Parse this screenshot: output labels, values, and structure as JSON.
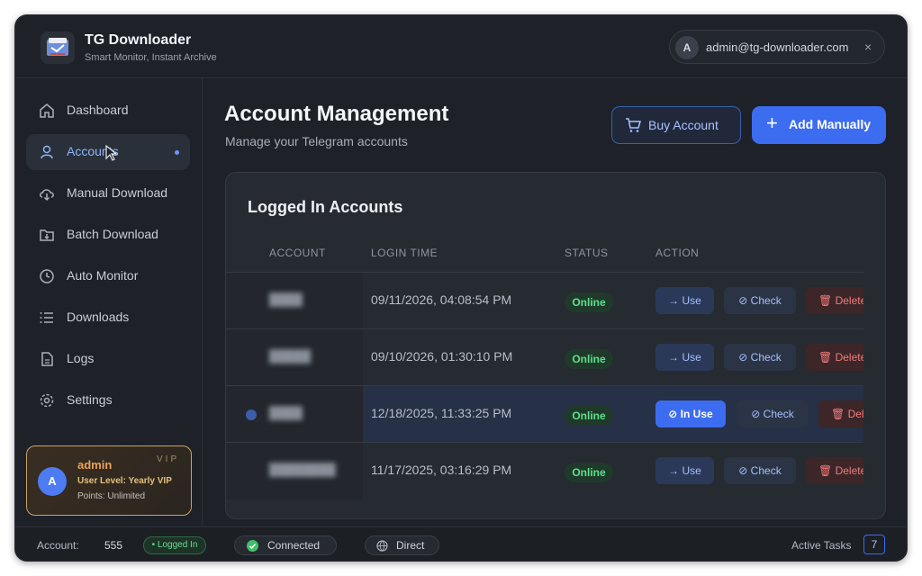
{
  "app": {
    "title": "TG Downloader",
    "subtitle": "Smart Monitor, Instant Archive"
  },
  "user": {
    "avatar_letter": "A",
    "email": "admin@tg-downloader.com",
    "close_glyph": "×"
  },
  "sidebar": {
    "items": [
      {
        "label": "Dashboard",
        "icon": "home-icon"
      },
      {
        "label": "Accounts",
        "icon": "user-icon",
        "active": true
      },
      {
        "label": "Manual Download",
        "icon": "cloud-download-icon"
      },
      {
        "label": "Batch Download",
        "icon": "folder-download-icon"
      },
      {
        "label": "Auto Monitor",
        "icon": "clock-icon"
      },
      {
        "label": "Downloads",
        "icon": "list-icon"
      },
      {
        "label": "Logs",
        "icon": "document-icon"
      },
      {
        "label": "Settings",
        "icon": "gear-icon"
      }
    ]
  },
  "vip": {
    "avatar_letter": "A",
    "name": "admin",
    "tag": "VIP",
    "level": "User Level:  Yearly VIP",
    "points": "Points: Unlimited",
    "accent": "#c9a265"
  },
  "page": {
    "title": "Account Management",
    "subtitle": "Manage your Telegram accounts",
    "buy_label": "Buy Account",
    "add_label": "Add Manually"
  },
  "table": {
    "title": "Logged In Accounts",
    "headers": {
      "account": "ACCOUNT",
      "login_time": "LOGIN TIME",
      "status": "STATUS",
      "action": "ACTION"
    },
    "use_label": "→ Use",
    "in_use_label": "⊘ In Use",
    "check_label": "⊘ Check",
    "delete_label": "🗑 Delete",
    "rows": [
      {
        "account": "████",
        "login_time": "09/11/2026, 04:08:54 PM",
        "status": "Online",
        "current": false
      },
      {
        "account": "█████",
        "login_time": "09/10/2026, 01:30:10 PM",
        "status": "Online",
        "current": false
      },
      {
        "account": "████",
        "login_time": "12/18/2025, 11:33:25 PM",
        "status": "Online",
        "current": true
      },
      {
        "account": "████████",
        "login_time": "11/17/2025, 03:16:29 PM",
        "status": "Online",
        "current": false
      }
    ]
  },
  "statusbar": {
    "account_label": "Account:",
    "account_value": "555",
    "logged_in": "• Logged In",
    "connected": "Connected",
    "direct": "Direct",
    "active_tasks_label": "Active Tasks",
    "active_tasks_count": "7"
  },
  "colors": {
    "accent": "#3c6cf0",
    "online": "#5fe08a",
    "danger": "#ef7c7c"
  }
}
